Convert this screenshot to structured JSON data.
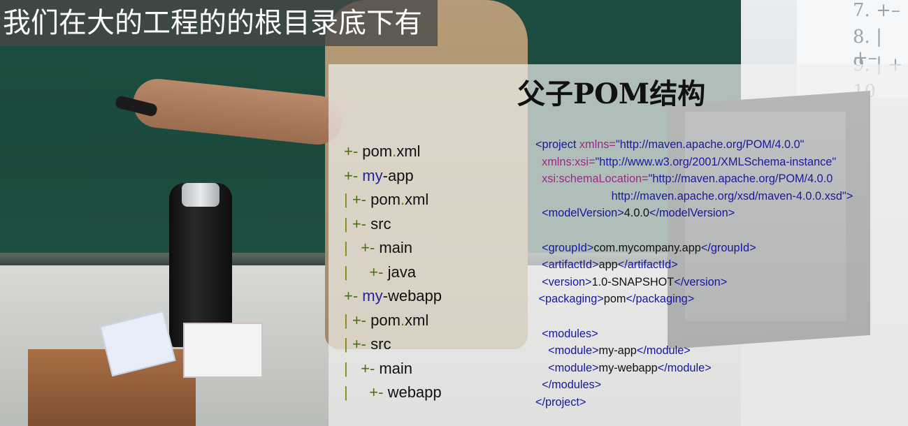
{
  "caption": {
    "text": "我们在大的工程的的根目录底下有"
  },
  "whiteboard": {
    "lines": [
      "7. +–",
      "8. | +–",
      "9. | +",
      "10"
    ]
  },
  "slide": {
    "title": "父子POM结构",
    "tree": [
      {
        "prefix": "+- ",
        "name": "pom.xml",
        "indent": ""
      },
      {
        "prefix": "+- ",
        "name": "my-app",
        "indent": ""
      },
      {
        "prefix": "+- ",
        "name": "pom.xml",
        "indent": "| "
      },
      {
        "prefix": "+- ",
        "name": "src",
        "indent": "| "
      },
      {
        "prefix": "+- ",
        "name": "main",
        "indent": "|   "
      },
      {
        "prefix": "+- ",
        "name": "java",
        "indent": "|     "
      },
      {
        "prefix": "+- ",
        "name": "my-webapp",
        "indent": ""
      },
      {
        "prefix": "+- ",
        "name": "pom.xml",
        "indent": "| "
      },
      {
        "prefix": "+- ",
        "name": "src",
        "indent": "| "
      },
      {
        "prefix": "+- ",
        "name": "main",
        "indent": "|   "
      },
      {
        "prefix": "+- ",
        "name": "webapp",
        "indent": "|     "
      }
    ],
    "xml": [
      {
        "indent": "",
        "parts": [
          [
            "tag",
            "<project "
          ],
          [
            "attr",
            "xmlns="
          ],
          [
            "val",
            "\"http://maven.apache.org/POM/4.0.0\""
          ]
        ]
      },
      {
        "indent": "  ",
        "parts": [
          [
            "attr",
            "xmlns:xsi="
          ],
          [
            "val",
            "\"http://www.w3.org/2001/XMLSchema-instance\""
          ]
        ]
      },
      {
        "indent": "  ",
        "parts": [
          [
            "attr",
            "xsi:schemaLocation="
          ],
          [
            "val",
            "\"http://maven.apache.org/POM/4.0.0"
          ]
        ]
      },
      {
        "indent": "                        ",
        "parts": [
          [
            "val",
            "http://maven.apache.org/xsd/maven-4.0.0.xsd\""
          ],
          [
            "tag",
            ">"
          ]
        ]
      },
      {
        "indent": "  ",
        "parts": [
          [
            "tag",
            "<modelVersion>"
          ],
          [
            "txt",
            "4.0.0"
          ],
          [
            "tag",
            "</modelVersion>"
          ]
        ]
      },
      {
        "indent": "",
        "parts": []
      },
      {
        "indent": "  ",
        "parts": [
          [
            "tag",
            "<groupId>"
          ],
          [
            "txt",
            "com.mycompany.app"
          ],
          [
            "tag",
            "</groupId>"
          ]
        ]
      },
      {
        "indent": "  ",
        "parts": [
          [
            "tag",
            "<artifactId>"
          ],
          [
            "txt",
            "app"
          ],
          [
            "tag",
            "</artifactId>"
          ]
        ]
      },
      {
        "indent": "  ",
        "parts": [
          [
            "tag",
            "<version>"
          ],
          [
            "txt",
            "1.0-SNAPSHOT"
          ],
          [
            "tag",
            "</version>"
          ]
        ]
      },
      {
        "indent": " ",
        "parts": [
          [
            "tag",
            "<packaging>"
          ],
          [
            "txt",
            "pom"
          ],
          [
            "tag",
            "</packaging>"
          ]
        ]
      },
      {
        "indent": "",
        "parts": []
      },
      {
        "indent": "  ",
        "parts": [
          [
            "tag",
            "<modules>"
          ]
        ]
      },
      {
        "indent": "    ",
        "parts": [
          [
            "tag",
            "<module>"
          ],
          [
            "txt",
            "my-app"
          ],
          [
            "tag",
            "</module>"
          ]
        ]
      },
      {
        "indent": "    ",
        "parts": [
          [
            "tag",
            "<module>"
          ],
          [
            "txt",
            "my-webapp"
          ],
          [
            "tag",
            "</module>"
          ]
        ]
      },
      {
        "indent": "  ",
        "parts": [
          [
            "tag",
            "</modules>"
          ]
        ]
      },
      {
        "indent": "",
        "parts": [
          [
            "tag",
            "</project>"
          ]
        ]
      }
    ]
  }
}
